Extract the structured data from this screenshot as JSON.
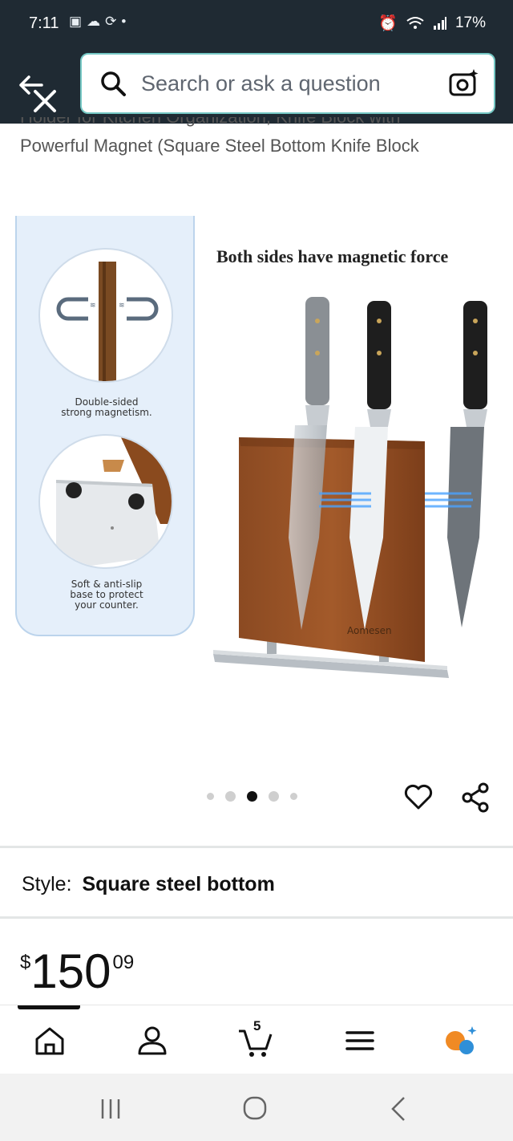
{
  "status_bar": {
    "time": "7:11",
    "battery": "17%"
  },
  "search": {
    "placeholder": "Search or ask a question"
  },
  "product": {
    "title_line1": "Holder for Kitchen Organization, Knife Block with",
    "title_line2": "Powerful Magnet (Square Steel Bottom Knife Block",
    "gallery": {
      "heading": "Both sides have magnetic force",
      "caption1": [
        "Double-sided",
        "strong magnetism."
      ],
      "caption2": [
        "Soft & anti-slip",
        "base to protect",
        "your counter."
      ],
      "brand_on_block": "Aomesen",
      "active_image_index": 3,
      "image_count": 5
    },
    "style_label": "Style:",
    "style_value": "Square steel bottom",
    "price": {
      "symbol": "$",
      "whole": "150",
      "fraction": "09"
    }
  },
  "bottom_nav": {
    "items": [
      {
        "name": "home",
        "icon": "home-icon"
      },
      {
        "name": "account",
        "icon": "person-icon"
      },
      {
        "name": "cart",
        "icon": "cart-icon",
        "count": "5"
      },
      {
        "name": "menu",
        "icon": "hamburger-icon"
      },
      {
        "name": "rufus",
        "icon": "ai-assistant-icon"
      }
    ]
  },
  "colors": {
    "header_bg": "#1f2a33",
    "search_border": "#74c7c4",
    "ai_orange": "#f08a24",
    "ai_blue": "#2f8fd8"
  }
}
